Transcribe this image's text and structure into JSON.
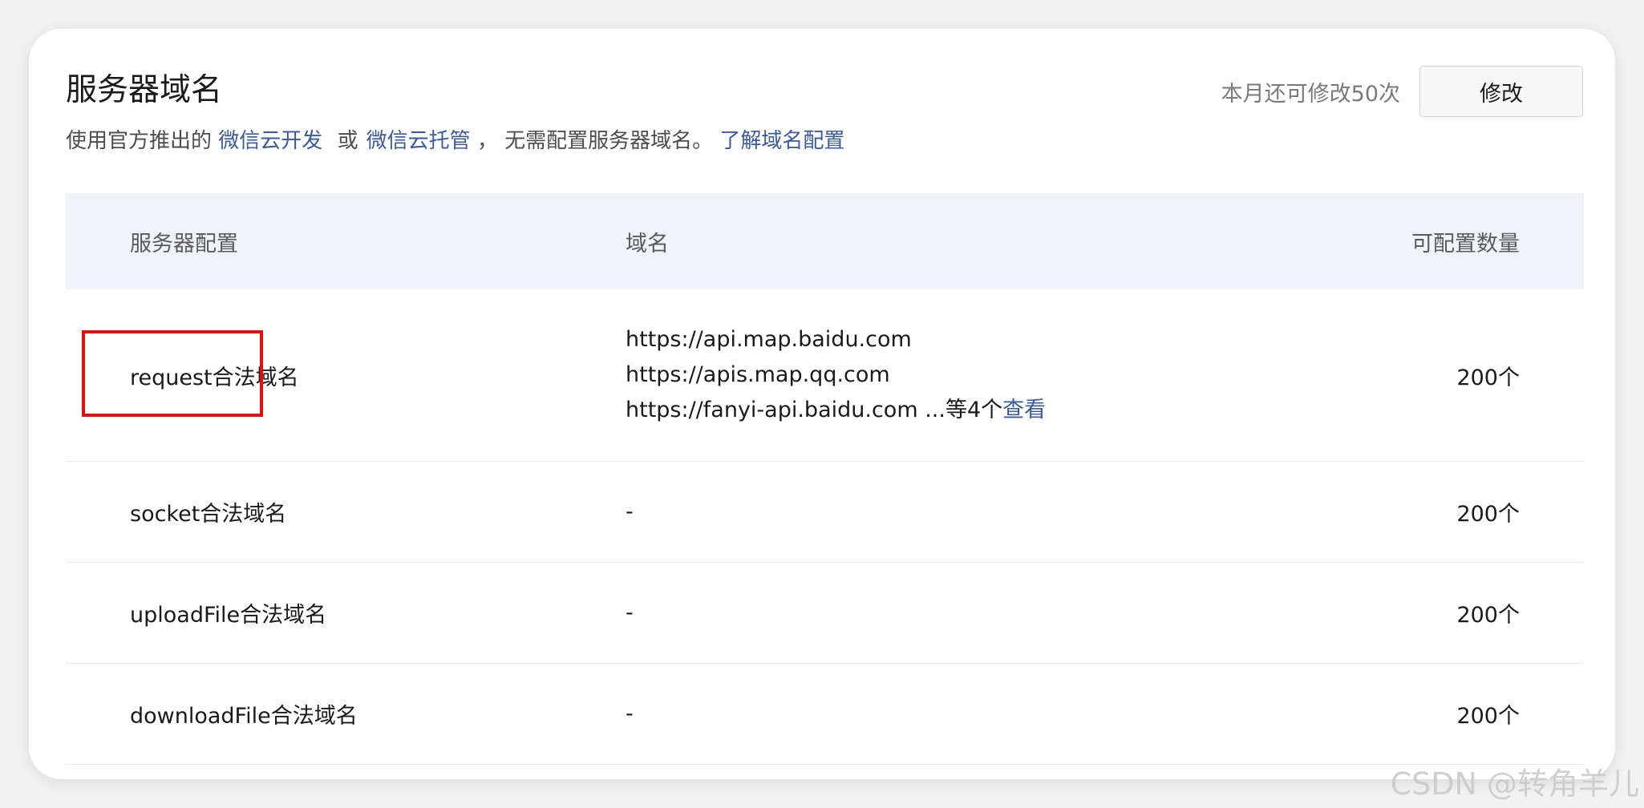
{
  "header": {
    "title": "服务器域名",
    "desc_prefix": "使用官方推出的",
    "link_cloud_dev": "微信云开发",
    "or_text": "或",
    "link_cloud_host": "微信云托管",
    "desc_suffix": "， 无需配置服务器域名。",
    "link_learn": "了解域名配置",
    "quota_text": "本月还可修改50次",
    "edit_button": "修改"
  },
  "table": {
    "columns": [
      "服务器配置",
      "域名",
      "可配置数量"
    ],
    "rows": [
      {
        "name": "request合法域名",
        "domains": [
          "https://api.map.baidu.com",
          "https://apis.map.qq.com",
          "https://fanyi-api.baidu.com"
        ],
        "more_text": " ...等4个",
        "view_link": "查看",
        "count": "200个"
      },
      {
        "name": "socket合法域名",
        "domain": "-",
        "count": "200个"
      },
      {
        "name": "uploadFile合法域名",
        "domain": "-",
        "count": "200个"
      },
      {
        "name": "downloadFile合法域名",
        "domain": "-",
        "count": "200个"
      }
    ]
  },
  "annotation": {
    "highlight_color": "#e01010"
  },
  "watermark": "CSDN @转角羊儿",
  "colors": {
    "link": "#3a5a9c",
    "table_header_bg": "#f0f4f8"
  }
}
